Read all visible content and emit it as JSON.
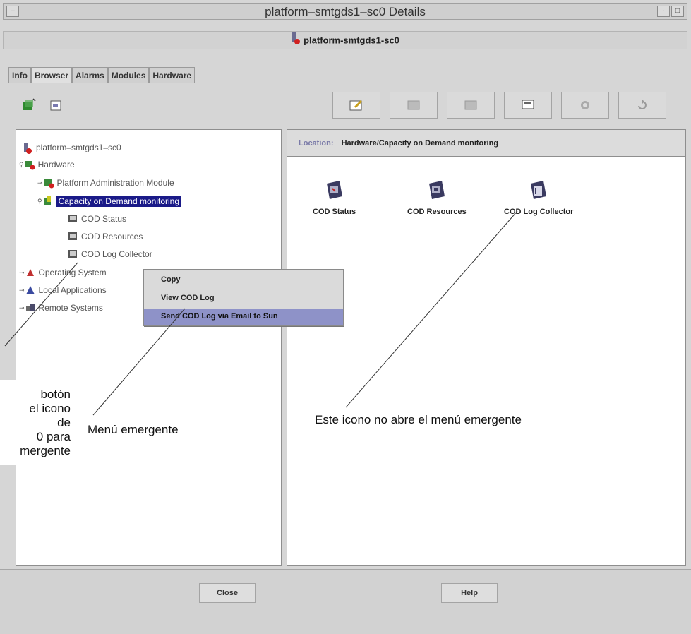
{
  "window": {
    "title": "platform–smtgds1–sc0 Details",
    "subtitle": "platform-smtgds1-sc0"
  },
  "tabs": [
    "Info",
    "Browser",
    "Alarms",
    "Modules",
    "Hardware"
  ],
  "location": {
    "label": "Location:",
    "value": "Hardware/Capacity on Demand monitoring"
  },
  "tree": [
    {
      "label": "platform–smtgds1–sc0",
      "icon": "host-icon"
    },
    {
      "label": "Hardware",
      "icon": "hardware-icon"
    },
    {
      "label": "Platform Administration Module",
      "icon": "module-icon"
    },
    {
      "label": "Capacity on Demand monitoring",
      "icon": "module-icon",
      "selected": true
    },
    {
      "label": "COD Status",
      "icon": "monitor-icon"
    },
    {
      "label": "COD Resources",
      "icon": "monitor-icon"
    },
    {
      "label": "COD Log Collector",
      "icon": "monitor-icon"
    },
    {
      "label": "Operating System",
      "icon": "os-icon"
    },
    {
      "label": "Local Applications",
      "icon": "apps-icon"
    },
    {
      "label": "Remote Systems",
      "icon": "remote-icon"
    }
  ],
  "content_icons": [
    {
      "label": "COD Status"
    },
    {
      "label": "COD Resources"
    },
    {
      "label": "COD Log Collector"
    }
  ],
  "context_menu": {
    "items": [
      "Copy",
      "View COD Log",
      "Send COD Log via Email to Sun"
    ],
    "highlighted_index": 2
  },
  "buttons": {
    "close": "Close",
    "help": "Help"
  },
  "captions": {
    "left": [
      "botón",
      "el icono",
      "de",
      "0 para",
      "mergente"
    ],
    "middle": "Menú emergente",
    "right": "Este icono no abre el menú emergente"
  },
  "colors": {
    "selection": "#1a1a88",
    "menu_highlight": "#8e92c8",
    "location_label": "#7a7aa8"
  }
}
